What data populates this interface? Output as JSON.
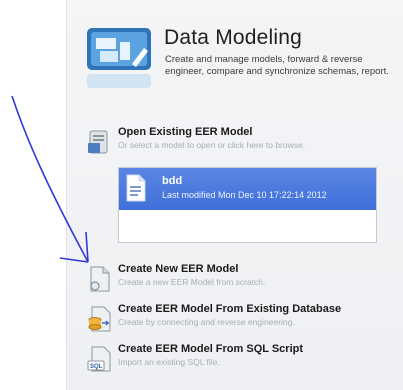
{
  "header": {
    "title": "Data Modeling",
    "subtitle": "Create and manage models, forward & reverse engineer, compare and synchronize schemas, report.",
    "icon": "data-modeling-icon"
  },
  "open_existing": {
    "label": "Open Existing EER Model",
    "hint": "Or select a model to open or click here to browse."
  },
  "recent_models": [
    {
      "name": "bdd",
      "meta": "Last modified Mon Dec 10 17:22:14 2012"
    }
  ],
  "actions": [
    {
      "label": "Create New EER Model",
      "hint": "Create a new EER Model from scratch."
    },
    {
      "label": "Create EER Model From Existing Database",
      "hint": "Create by connecting and reverse engineering."
    },
    {
      "label": "Create EER Model From SQL Script",
      "hint": "Import an existing SQL file."
    }
  ],
  "colors": {
    "selection": "#4a78dd",
    "annotation_arrow": "#2f3bd8"
  }
}
